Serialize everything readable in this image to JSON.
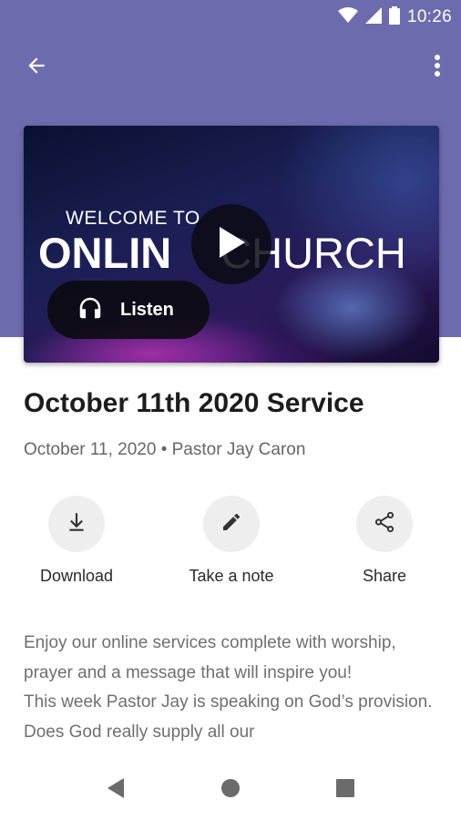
{
  "status_bar": {
    "time": "10:26",
    "icons": [
      "wifi-icon",
      "cellular-signal-icon",
      "battery-icon"
    ]
  },
  "app_bar": {
    "back_icon": "arrow-back-icon",
    "menu_icon": "more-vert-icon"
  },
  "media": {
    "thumbnail_line1": "WELCOME TO",
    "thumbnail_line2_bold": "ONLIN",
    "thumbnail_line2_light": "CHURCH",
    "play_icon": "play-icon",
    "listen_label": "Listen",
    "listen_icon": "headphones-icon"
  },
  "sermon": {
    "title": "October 11th 2020 Service",
    "meta": "October 11, 2020 • Pastor Jay Caron"
  },
  "actions": [
    {
      "label": "Download",
      "icon": "download-icon"
    },
    {
      "label": "Take a note",
      "icon": "pencil-icon"
    },
    {
      "label": "Share",
      "icon": "share-icon"
    }
  ],
  "description": {
    "line1": "Enjoy our online services complete with worship, prayer and a message that will inspire you!",
    "line2": "This week Pastor Jay is speaking on God’s provision. Does God really supply all our"
  },
  "nav": {
    "icons": [
      "nav-back-icon",
      "nav-home-icon",
      "nav-recents-icon"
    ]
  },
  "colors": {
    "header": "#6c6bae",
    "text_primary": "#1c1c1c",
    "text_secondary": "#666666",
    "action_bg": "#eeeeee"
  }
}
